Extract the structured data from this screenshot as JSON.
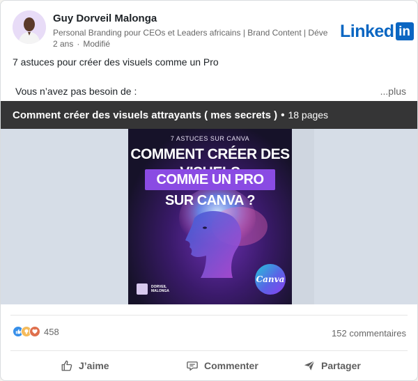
{
  "post": {
    "author_name": "Guy Dorveil Malonga",
    "author_headline": "Personal Branding pour CEOs et Leaders africains | Brand Content | Dével…",
    "time": "2 ans",
    "edited": "Modifié",
    "brand_logo_text": "Linked",
    "brand_logo_box": "in",
    "text_line1": "7 astuces pour créer des visuels comme un Pro",
    "text_line2": "Vous n’avez pas besoin de :",
    "see_more": "...plus"
  },
  "document": {
    "title": "Comment créer des visuels attrayants ( mes secrets )",
    "separator": "•",
    "pages": "18 pages",
    "cover": {
      "kicker": "7 ASTUCES SUR CANVA",
      "title_line1": "COMMENT CRÉER DES VISUELS",
      "title_line2": "COMME UN PRO SUR CANVA ?",
      "badge": "Canva",
      "author_line1": "DORVEIL",
      "author_line2": "MALONGA"
    }
  },
  "social": {
    "reaction_count": "458",
    "comments": "152 commentaires"
  },
  "actions": {
    "like": "J’aime",
    "comment": "Commenter",
    "share": "Partager"
  },
  "colors": {
    "brand": "#0a66c2",
    "cover_accent": "#8a4be3"
  }
}
